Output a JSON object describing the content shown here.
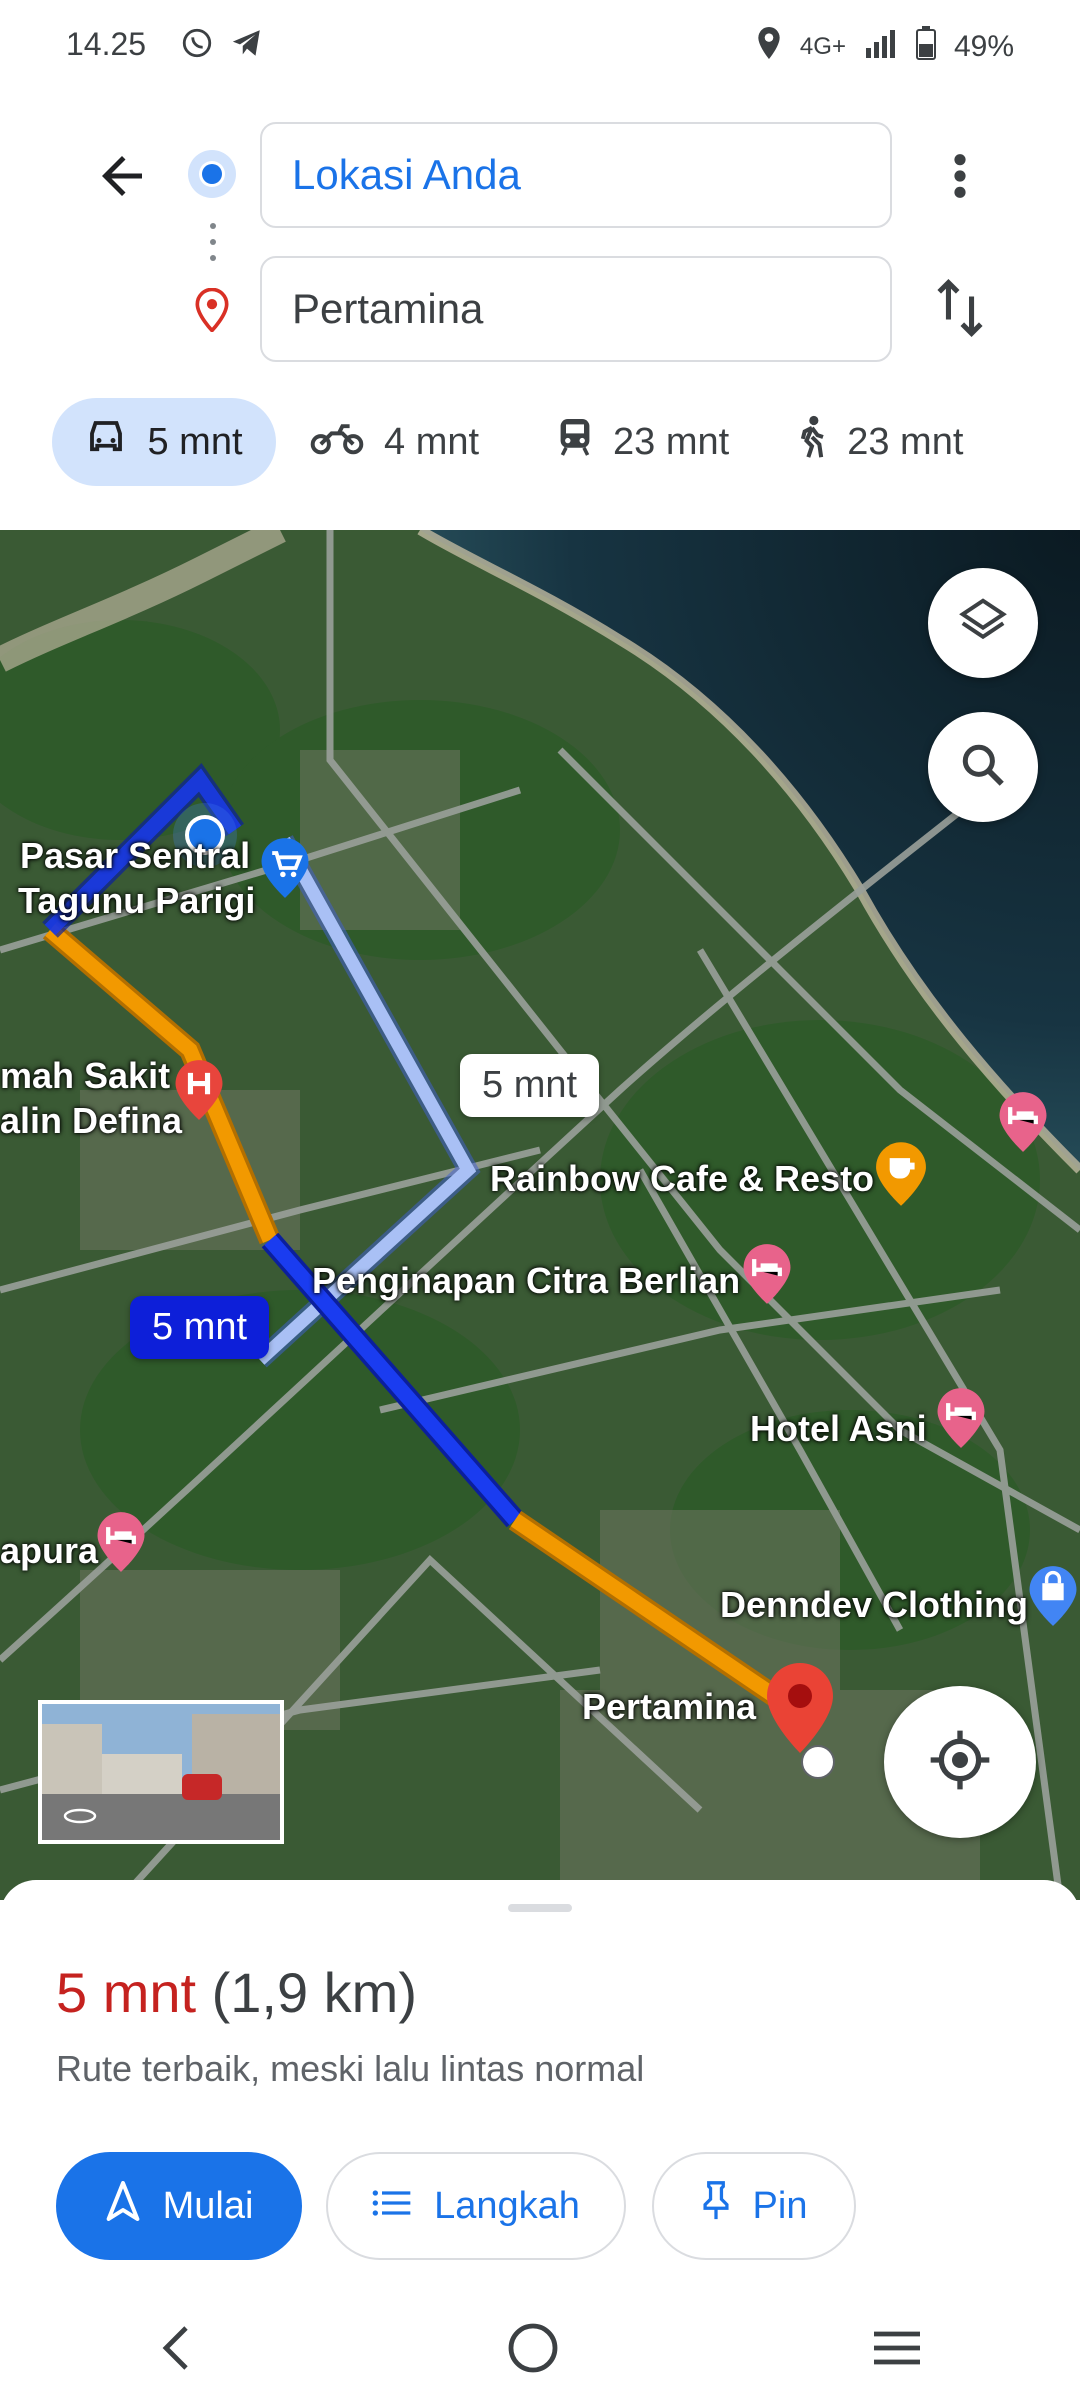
{
  "status": {
    "time": "14.25",
    "network": "4G+",
    "battery": "49%"
  },
  "directions": {
    "origin": "Lokasi Anda",
    "destination": "Pertamina"
  },
  "modes": [
    {
      "name": "car",
      "label": "5 mnt",
      "active": true
    },
    {
      "name": "motorcycle",
      "label": "4 mnt",
      "active": false
    },
    {
      "name": "transit",
      "label": "23 mnt",
      "active": false
    },
    {
      "name": "walk",
      "label": "23 mnt",
      "active": false
    }
  ],
  "map": {
    "places": {
      "pasar_line1": "Pasar Sentral",
      "pasar_line2": "Tagunu Parigi",
      "rs_line1": "mah Sakit",
      "rs_line2": "alin Defina",
      "rainbow": "Rainbow Cafe & Resto",
      "penginapan": "Penginapan Citra Berlian",
      "hotel": "Hotel Asni",
      "apura": "apura",
      "denndev": "Denndev Clothing",
      "pertamina": "Pertamina"
    },
    "alt_route_time": "5 mnt",
    "main_route_time": "5 mnt",
    "colors": {
      "main_route": "#1a3cf0",
      "traffic": "#f29900",
      "alt_route": "#a9c0f5"
    }
  },
  "sheet": {
    "time": "5 mnt",
    "distance": "(1,9 km)",
    "description": "Rute terbaik, meski lalu lintas normal",
    "start_label": "Mulai",
    "steps_label": "Langkah",
    "pin_label": "Pin"
  }
}
